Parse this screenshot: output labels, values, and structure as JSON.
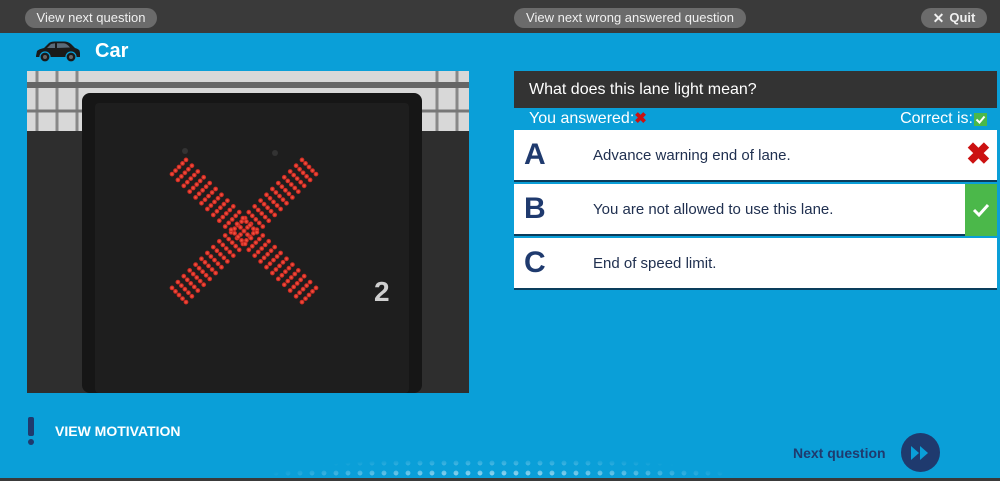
{
  "topbar": {
    "view_next_label": "View next question",
    "view_wrong_label": "View next wrong answered question",
    "quit_label": "Quit",
    "quit_icon": "close-icon"
  },
  "category": {
    "label": "Car",
    "icon": "car-icon"
  },
  "image": {
    "sign_number": "2",
    "depicts": "overhead lane signal showing a red X"
  },
  "question": {
    "text": "What does this lane light mean?",
    "you_answered_label": "You answered:",
    "correct_is_label": "Correct is:"
  },
  "options": [
    {
      "letter": "A",
      "text": "Advance warning end of lane.",
      "state": "wrong-selected"
    },
    {
      "letter": "B",
      "text": "You are not allowed to use this lane.",
      "state": "correct"
    },
    {
      "letter": "C",
      "text": "End of speed limit.",
      "state": "none"
    }
  ],
  "footer": {
    "motivation_label": "VIEW MOTIVATION",
    "next_question_label": "Next question"
  },
  "colors": {
    "background": "#0a9fd8",
    "topbar": "#3a3a3a",
    "navy": "#1f3a6e",
    "correct_green": "#4bb84a",
    "wrong_red": "#cc1111",
    "signal_red": "#e8382a"
  }
}
